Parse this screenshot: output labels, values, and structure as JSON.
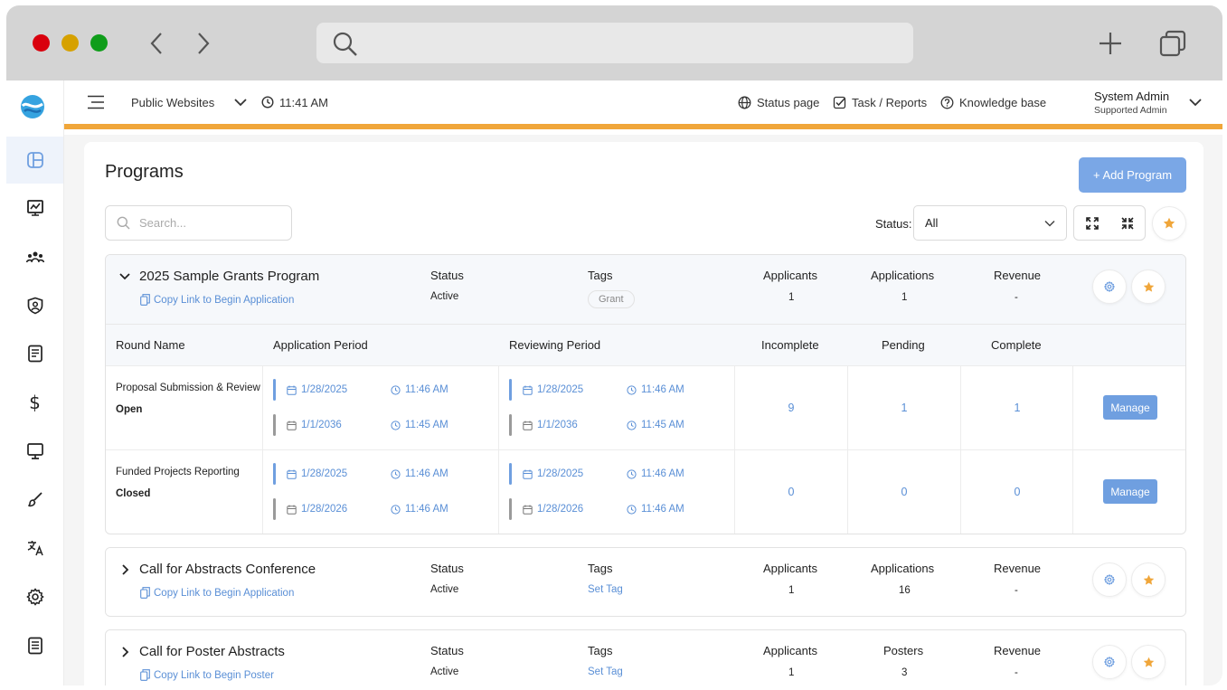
{
  "topbar": {
    "site_selector": "Public Websites",
    "time": "11:41 AM",
    "status_page": "Status page",
    "task_reports": "Task / Reports",
    "knowledge_base": "Knowledge base",
    "user_name": "System Admin",
    "user_role": "Supported Admin"
  },
  "page": {
    "title": "Programs",
    "add_button": "+ Add Program",
    "search_placeholder": "Search...",
    "status_label": "Status:",
    "status_value": "All"
  },
  "programs": [
    {
      "title": "2025 Sample Grants Program",
      "link": "Copy Link to Begin Application",
      "status_h": "Status",
      "status": "Active",
      "tags_h": "Tags",
      "tag": "Grant",
      "applicants_h": "Applicants",
      "applicants": "1",
      "applications_h": "Applications",
      "applications": "1",
      "revenue_h": "Revenue",
      "revenue": "-",
      "rounds_header": {
        "round_name": "Round Name",
        "application_period": "Application Period",
        "reviewing_period": "Reviewing Period",
        "incomplete": "Incomplete",
        "pending": "Pending",
        "complete": "Complete"
      },
      "rounds": [
        {
          "name": "Proposal Submission & Review",
          "state": "Open",
          "app_start_date": "1/28/2025",
          "app_start_time": "11:46 AM",
          "app_end_date": "1/1/2036",
          "app_end_time": "11:45 AM",
          "rev_start_date": "1/28/2025",
          "rev_start_time": "11:46 AM",
          "rev_end_date": "1/1/2036",
          "rev_end_time": "11:45 AM",
          "incomplete": "9",
          "pending": "1",
          "complete": "1",
          "manage": "Manage"
        },
        {
          "name": "Funded Projects Reporting",
          "state": "Closed",
          "app_start_date": "1/28/2025",
          "app_start_time": "11:46 AM",
          "app_end_date": "1/28/2026",
          "app_end_time": "11:46 AM",
          "rev_start_date": "1/28/2025",
          "rev_start_time": "11:46 AM",
          "rev_end_date": "1/28/2026",
          "rev_end_time": "11:46 AM",
          "incomplete": "0",
          "pending": "0",
          "complete": "0",
          "manage": "Manage"
        }
      ]
    },
    {
      "title": "Call for Abstracts Conference",
      "link": "Copy Link to Begin Application",
      "status_h": "Status",
      "status": "Active",
      "tags_h": "Tags",
      "tag": "Set Tag",
      "applicants_h": "Applicants",
      "applicants": "1",
      "applications_h": "Applications",
      "applications": "16",
      "revenue_h": "Revenue",
      "revenue": "-"
    },
    {
      "title": "Call for Poster Abstracts",
      "link": "Copy Link to Begin Poster",
      "status_h": "Status",
      "status": "Active",
      "tags_h": "Tags",
      "tag": "Set Tag",
      "applicants_h": "Applicants",
      "applicants": "1",
      "applications_h": "Posters",
      "applications": "3",
      "revenue_h": "Revenue",
      "revenue": "-"
    }
  ],
  "colors": {
    "accent_blue": "#6f9fe0",
    "link_blue": "#5a8fd6",
    "orange_bar": "#f0a63a",
    "star": "#f0a63a",
    "end_bar_grey": "#9a9a9a"
  },
  "icons": [
    "search-icon",
    "menu-icon",
    "clock-icon",
    "globe-icon",
    "checkbox-icon",
    "help-icon",
    "chevron-down-icon",
    "expand-icon",
    "collapse-icon",
    "star-icon",
    "gear-icon",
    "copy-icon",
    "calendar-icon"
  ]
}
